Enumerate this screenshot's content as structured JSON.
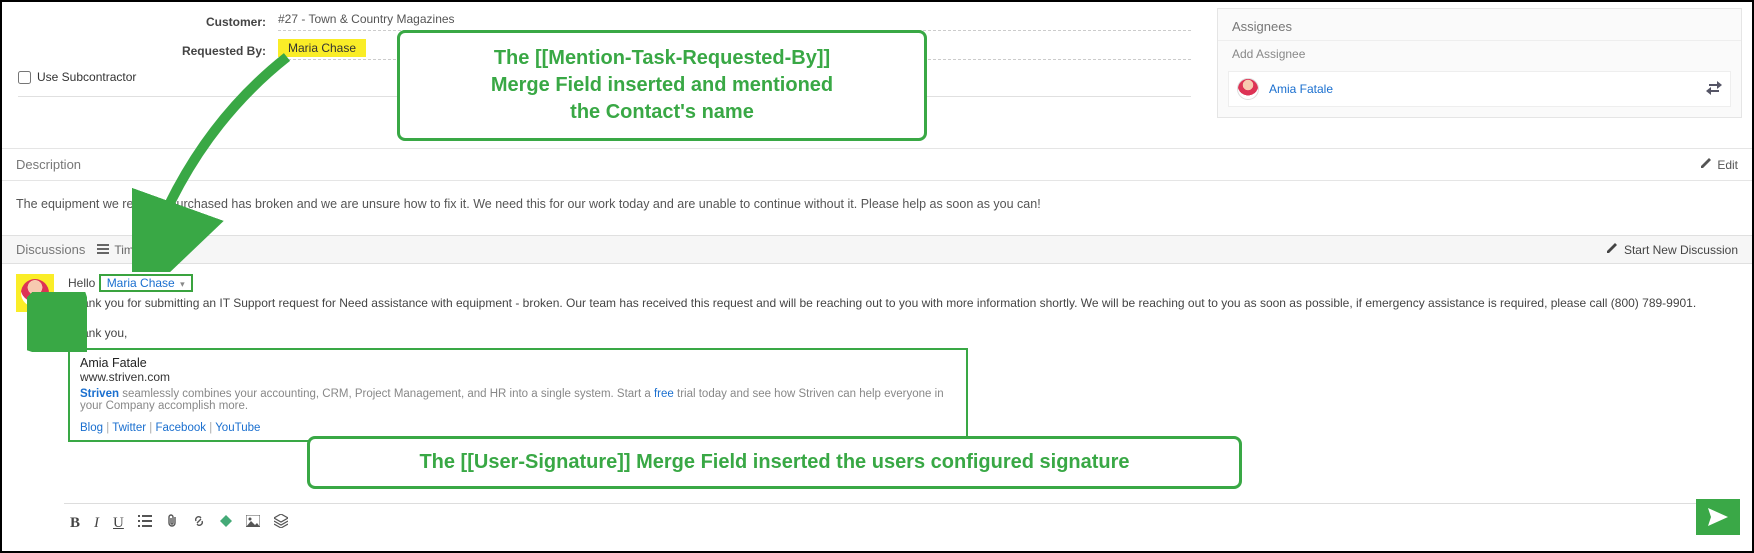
{
  "fields": {
    "customer_label": "Customer:",
    "customer_value": "#27 - Town & Country Magazines",
    "requested_by_label": "Requested By:",
    "requested_by_value": "Maria Chase",
    "subcontractor_label": "Use Subcontractor"
  },
  "assignees": {
    "title": "Assignees",
    "add_label": "Add Assignee",
    "items": [
      {
        "name": "Amia Fatale"
      }
    ]
  },
  "description": {
    "title": "Description",
    "edit_label": "Edit",
    "body": "The equipment we recently purchased has broken and we are unsure how to fix it. We need this for our work today and are unable to continue without it. Please help as soon as you can!"
  },
  "discussions": {
    "title": "Discussions",
    "timeline_label": "Timeline",
    "new_label": "Start New Discussion"
  },
  "message": {
    "greeting_prefix": "Hello ",
    "mention_name": "Maria Chase",
    "body": "Thank you for submitting an IT Support request for Need assistance with equipment - broken. Our team has received this request and will be reaching out to you with more information shortly. We will be reaching out to you as soon as possible, if emergency assistance is required, please call (800) 789-9901.",
    "closing": "Thank you,"
  },
  "signature": {
    "name": "Amia Fatale",
    "site": "www.striven.com",
    "brand": "Striven",
    "tagline_mid": " seamlessly combines your accounting, CRM, Project Management, and HR into a single system. Start a ",
    "free_word": "free",
    "tagline_end": " trial today and see how Striven can help everyone in your Company accomplish more.",
    "links": [
      "Blog",
      "Twitter",
      "Facebook",
      "YouTube"
    ]
  },
  "callouts": {
    "c1_l1": "The [[Mention-Task-Requested-By]]",
    "c1_l2": "Merge Field inserted and mentioned",
    "c1_l3": "the Contact's name",
    "c2": "The [[User-Signature]] Merge Field inserted the users configured signature"
  }
}
